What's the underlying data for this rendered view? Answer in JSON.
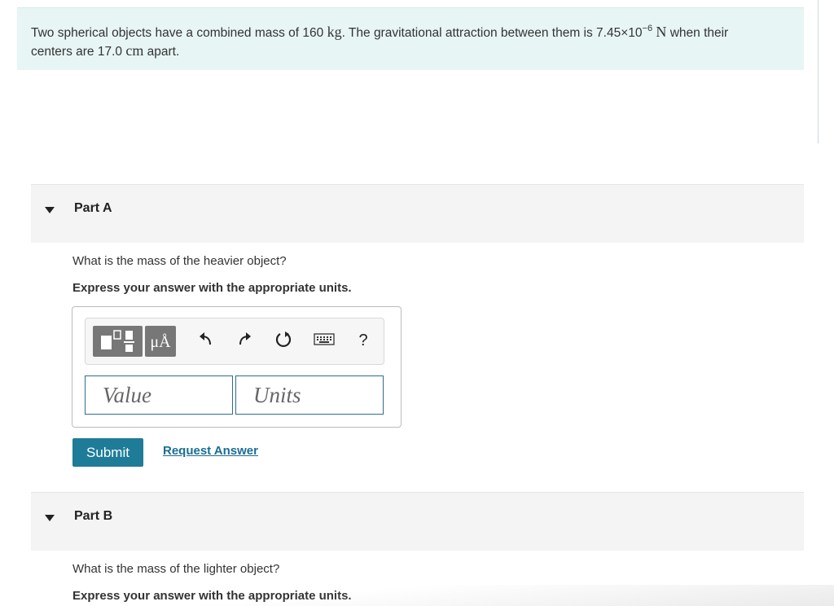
{
  "problem": {
    "text_1": "Two spherical objects have a combined mass of 160",
    "unit_kg": "kg",
    "text_2": ". The gravitational attraction between them is 7.45×10",
    "exponent": "−6",
    "unit_N": "N",
    "text_3": "when their",
    "text_4": "centers are 17.0",
    "unit_cm": "cm",
    "text_5": "apart."
  },
  "parts": [
    {
      "title": "Part A",
      "question": "What is the mass of the heavier object?",
      "instruction": "Express your answer with the appropriate units."
    },
    {
      "title": "Part B",
      "question": "What is the mass of the lighter object?",
      "instruction": "Express your answer with the appropriate units."
    }
  ],
  "toolbar": {
    "units_glyph": "μÅ",
    "help_glyph": "?",
    "icons": [
      "templates-icon",
      "units-icon",
      "undo-icon",
      "redo-icon",
      "reset-icon",
      "keyboard-icon",
      "help-icon"
    ]
  },
  "answer": {
    "value_placeholder": "Value",
    "units_placeholder": "Units"
  },
  "actions": {
    "submit_label": "Submit",
    "request_label": "Request Answer"
  },
  "colors": {
    "problem_bg": "#e8f5f5",
    "submit_bg": "#1e7c99",
    "link": "#1a6d94",
    "field_border": "#2f6c8f"
  }
}
